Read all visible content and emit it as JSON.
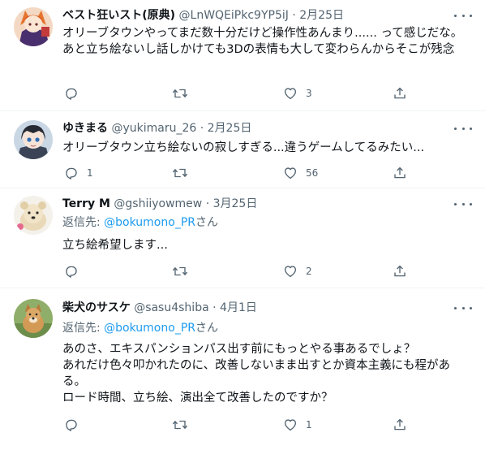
{
  "tweets": [
    {
      "display_name": "ベスト狂いスト(原典)",
      "handle": "@LnWQEiPkc9YP5iJ",
      "separator": "·",
      "date": "2月25日",
      "reply_prefix": "",
      "reply_mention": "",
      "reply_suffix": "",
      "text": "オリーブタウンやってまだ数十分だけど操作性あんまり...... って感じだな。あと立ち絵ないし話しかけても3Dの表情も大して変わらんからそこが残念",
      "counts": {
        "reply": "",
        "retweet": "",
        "like": "3"
      }
    },
    {
      "display_name": "ゆきまる",
      "handle": "@yukimaru_26",
      "separator": "·",
      "date": "2月25日",
      "reply_prefix": "",
      "reply_mention": "",
      "reply_suffix": "",
      "text": "オリーブタウン立ち絵ないの寂しすぎる...違うゲームしてるみたい...",
      "counts": {
        "reply": "1",
        "retweet": "",
        "like": "56"
      }
    },
    {
      "display_name": "Terry M",
      "handle": "@gshiiyowmew",
      "separator": "·",
      "date": "3月25日",
      "reply_prefix": "返信先: ",
      "reply_mention": "@bokumono_PR",
      "reply_suffix": "さん",
      "text": "立ち絵希望します...",
      "counts": {
        "reply": "",
        "retweet": "",
        "like": "2"
      }
    },
    {
      "display_name": "柴犬のサスケ",
      "handle": "@sasu4shiba",
      "separator": "·",
      "date": "4月1日",
      "reply_prefix": "返信先: ",
      "reply_mention": "@bokumono_PR",
      "reply_suffix": "さん",
      "text": "あのさ、エキスパンションパス出す前にもっとやる事あるでしょ？\nあれだけ色々叩かれたのに、改善しないまま出すとか資本主義にも程がある。\nロード時間、立ち絵、演出全て改善したのですか？",
      "counts": {
        "reply": "",
        "retweet": "",
        "like": "1"
      }
    }
  ],
  "icons": {
    "reply": "reply-icon",
    "retweet": "retweet-icon",
    "like": "heart-icon",
    "share": "share-icon",
    "more": "more-dots-icon"
  },
  "colors": {
    "text_primary": "#0f1419",
    "text_secondary": "#536471",
    "link": "#1d9bf0",
    "divider": "#eff3f4"
  }
}
